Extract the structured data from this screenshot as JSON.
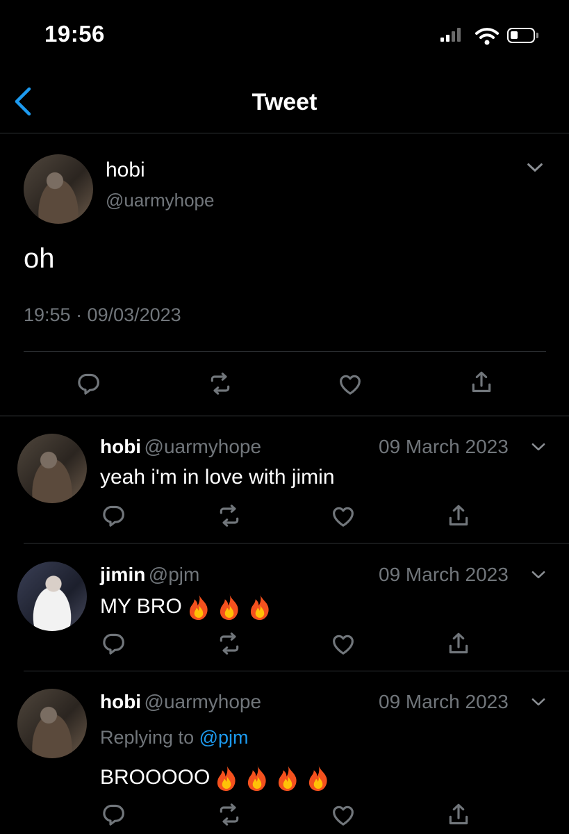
{
  "status_bar": {
    "time": "19:56"
  },
  "header": {
    "title": "Tweet"
  },
  "main_tweet": {
    "name": "hobi",
    "handle": "@uarmyhope",
    "text": "oh",
    "timestamp": "19:55 · 09/03/2023"
  },
  "replies": [
    {
      "name": "hobi",
      "handle": "@uarmyhope",
      "date": "09 March 2023",
      "text": "yeah i'm in love with jimin",
      "fire_count": 0
    },
    {
      "name": "jimin",
      "handle": "@pjm",
      "date": "09 March 2023",
      "text": "MY BRO",
      "fire_count": 3
    },
    {
      "name": "hobi",
      "handle": "@uarmyhope",
      "date": "09 March 2023",
      "replying_label": "Replying to",
      "replying_to": "@pjm",
      "text": "BROOOOO",
      "fire_count": 4
    }
  ],
  "icons": [
    "back-chevron-icon",
    "chevron-down-icon",
    "reply-icon",
    "retweet-icon",
    "like-icon",
    "share-icon",
    "fire-emoji"
  ],
  "colors": {
    "background": "#000000",
    "text": "#e7e9ea",
    "muted": "#71767b",
    "accent": "#1d9bf0",
    "divider": "#2f3336"
  }
}
